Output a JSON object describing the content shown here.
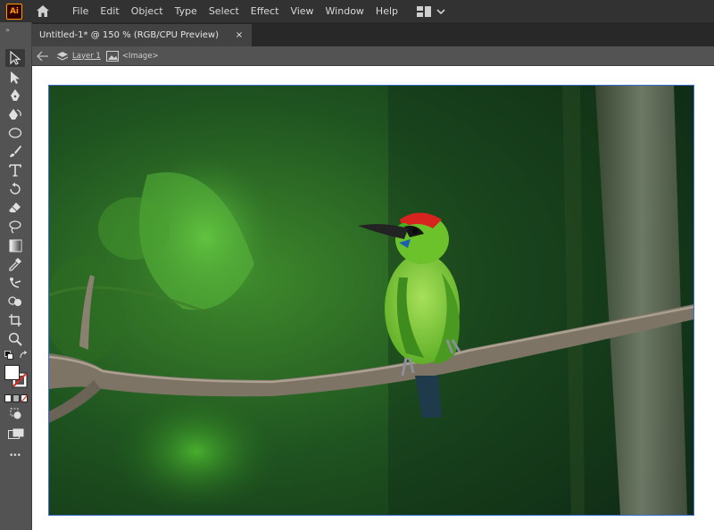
{
  "app": {
    "logo": "Ai",
    "colors": {
      "menubar": "#323232",
      "panel": "#535353",
      "tab": "#424242",
      "selection": "#3d6fd1",
      "logo_accent": "#ff9a00"
    }
  },
  "menu": {
    "items": [
      "File",
      "Edit",
      "Object",
      "Type",
      "Select",
      "Effect",
      "View",
      "Window",
      "Help"
    ]
  },
  "icons": {
    "home": "home-icon",
    "workspace": "workspace-switcher-icon",
    "chevron": "chevron-down-icon"
  },
  "document": {
    "tab_title": "Untitled-1* @ 150 % (RGB/CPU Preview)",
    "close_glyph": "×"
  },
  "breadcrumb": {
    "layer": "Layer 1",
    "object": "<Image>"
  },
  "toolbar": {
    "grip": "»",
    "more": "•••",
    "tools": [
      "selection-tool-icon",
      "direct-selection-tool-icon",
      "pen-tool-icon",
      "curvature-tool-icon",
      "ellipse-tool-icon",
      "paintbrush-tool-icon",
      "type-tool-icon",
      "rotate-tool-icon",
      "eraser-tool-icon",
      "lasso-tool-icon",
      "gradient-tool-icon",
      "eyedropper-tool-icon",
      "puppet-warp-tool-icon",
      "shape-builder-tool-icon",
      "artboard-tool-icon",
      "zoom-tool-icon"
    ]
  }
}
